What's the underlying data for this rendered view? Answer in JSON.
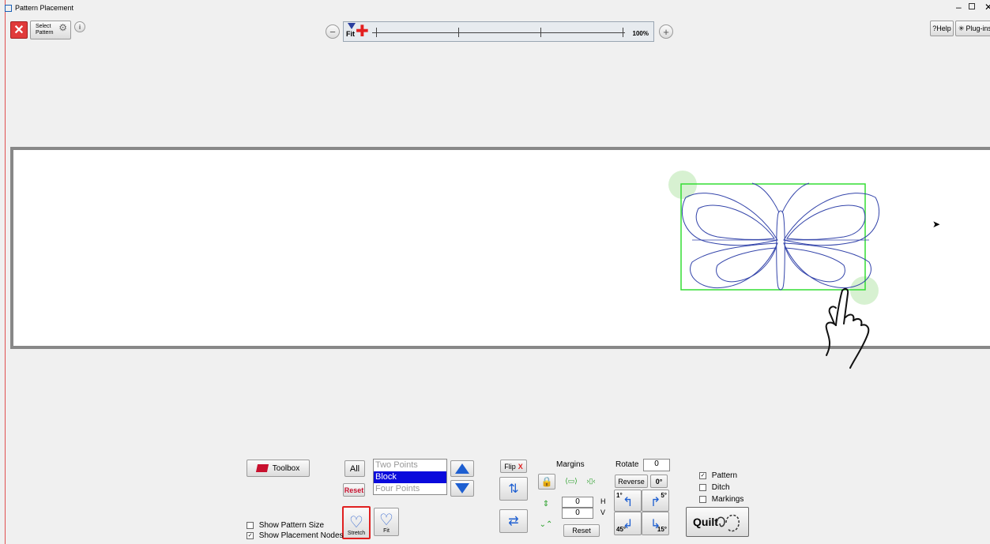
{
  "window": {
    "title": "Pattern Placement",
    "minimize_glyph": "–",
    "close_glyph": "✕"
  },
  "toolbar": {
    "close_glyph": "✕",
    "select_pattern_label": "Select Pattern",
    "info_glyph": "i",
    "zoom_fit_label": "Fit",
    "zoom_max_label": "100%",
    "zoom_out_glyph": "−",
    "zoom_in_glyph": "+",
    "help_label": "?Help",
    "plugins_label": "Plug-ins"
  },
  "controls": {
    "toolbox_label": "Toolbox",
    "all_label": "All",
    "reset_label": "Reset",
    "selection_modes": [
      {
        "label": "Two Points",
        "selected": false
      },
      {
        "label": "Block",
        "selected": true
      },
      {
        "label": "Four Points",
        "selected": false
      }
    ],
    "stretch_label": "Stretch",
    "fit_label": "Fit",
    "show_pattern_size": {
      "label": "Show Pattern Size",
      "checked": false
    },
    "show_placement_nodes": {
      "label": "Show Placement Nodes",
      "checked": true
    }
  },
  "flip": {
    "label": "Flip",
    "x_label": "X"
  },
  "margins": {
    "title": "Margins",
    "h_value": "0",
    "v_value": "0",
    "h_unit": "H",
    "v_unit": "V",
    "reset_label": "Reset"
  },
  "rotate": {
    "label": "Rotate",
    "value": "0",
    "reverse_label": "Reverse",
    "zero_label": "0°",
    "steps": [
      "1°",
      "5°",
      "45°",
      "15°"
    ]
  },
  "layers": {
    "pattern": {
      "label": "Pattern",
      "checked": true
    },
    "ditch": {
      "label": "Ditch",
      "checked": false
    },
    "markings": {
      "label": "Markings",
      "checked": false
    }
  },
  "quilt_button_label": "Quilt",
  "colors": {
    "selection_blue": "#0a0adc",
    "arrow_blue": "#1e5fd1",
    "bounding_box_green": "#33dd33",
    "pattern_stroke": "#3344aa",
    "close_red": "#e03a3a"
  },
  "icons": [
    "close-icon",
    "gears-icon",
    "info-icon",
    "zoom-out-icon",
    "zoom-in-icon",
    "toolbox-icon",
    "up-arrow-icon",
    "down-arrow-icon",
    "heart-icon",
    "lock-icon",
    "rotate-arrow-icon",
    "hand-cursor-icon"
  ]
}
